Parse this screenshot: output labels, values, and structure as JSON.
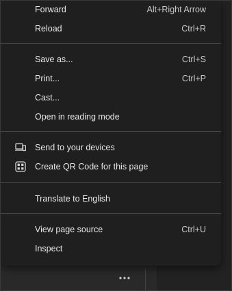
{
  "menu": {
    "items": [
      {
        "label": "Forward",
        "shortcut": "Alt+Right Arrow"
      },
      {
        "label": "Reload",
        "shortcut": "Ctrl+R"
      },
      {
        "label": "Save as...",
        "shortcut": "Ctrl+S"
      },
      {
        "label": "Print...",
        "shortcut": "Ctrl+P"
      },
      {
        "label": "Cast...",
        "shortcut": ""
      },
      {
        "label": "Open in reading mode",
        "shortcut": ""
      },
      {
        "label": "Send to your devices",
        "shortcut": "",
        "icon": "send-to-devices-icon"
      },
      {
        "label": "Create QR Code for this page",
        "shortcut": "",
        "icon": "qr-code-icon"
      },
      {
        "label": "Translate to English",
        "shortcut": ""
      },
      {
        "label": "View page source",
        "shortcut": "Ctrl+U"
      },
      {
        "label": "Inspect",
        "shortcut": ""
      }
    ]
  },
  "toolbar": {
    "more_icon": "more-horizontal-icon"
  },
  "colors": {
    "menu_bg": "#1f1f1f",
    "page_bg": "#292929",
    "text": "#e8e8e8",
    "separator": "#474747"
  }
}
